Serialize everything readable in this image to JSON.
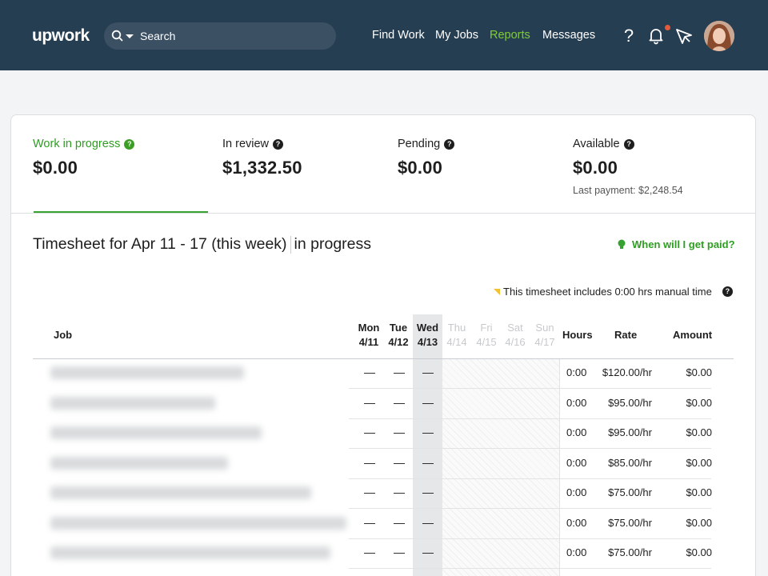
{
  "header": {
    "logo": "upwork",
    "search_placeholder": "Search",
    "nav": [
      "Find Work",
      "My Jobs",
      "Reports",
      "Messages"
    ],
    "active_nav": "Reports",
    "help_glyph": "?"
  },
  "stats": [
    {
      "label": "Work in progress",
      "value": "$0.00",
      "sub": ""
    },
    {
      "label": "In review",
      "value": "$1,332.50",
      "sub": ""
    },
    {
      "label": "Pending",
      "value": "$0.00",
      "sub": ""
    },
    {
      "label": "Available",
      "value": "$0.00",
      "sub": "Last payment: $2,248.54"
    }
  ],
  "timesheet": {
    "title": "Timesheet for Apr 11 - 17 (this week)",
    "status": "in progress",
    "paid_link": "When will I get paid?",
    "manual_note": "This timesheet includes 0:00 hrs manual time"
  },
  "table": {
    "columns": {
      "job": "Job",
      "days": [
        {
          "day": "Mon",
          "date": "4/11"
        },
        {
          "day": "Tue",
          "date": "4/12"
        },
        {
          "day": "Wed",
          "date": "4/13"
        },
        {
          "day": "Thu",
          "date": "4/14"
        },
        {
          "day": "Fri",
          "date": "4/15"
        },
        {
          "day": "Sat",
          "date": "4/16"
        },
        {
          "day": "Sun",
          "date": "4/17"
        }
      ],
      "hours": "Hours",
      "rate": "Rate",
      "amount": "Amount"
    },
    "dash": "—",
    "rows": [
      {
        "hours": "0:00",
        "rate": "$120.00/hr",
        "amount": "$0.00"
      },
      {
        "hours": "0:00",
        "rate": "$95.00/hr",
        "amount": "$0.00"
      },
      {
        "hours": "0:00",
        "rate": "$95.00/hr",
        "amount": "$0.00"
      },
      {
        "hours": "0:00",
        "rate": "$85.00/hr",
        "amount": "$0.00"
      },
      {
        "hours": "0:00",
        "rate": "$75.00/hr",
        "amount": "$0.00"
      },
      {
        "hours": "0:00",
        "rate": "$75.00/hr",
        "amount": "$0.00"
      },
      {
        "hours": "0:00",
        "rate": "$75.00/hr",
        "amount": "$0.00"
      }
    ]
  },
  "colors": {
    "header_bg": "#263e52",
    "accent_green": "#37a232",
    "active_nav": "#7fcc3a"
  }
}
